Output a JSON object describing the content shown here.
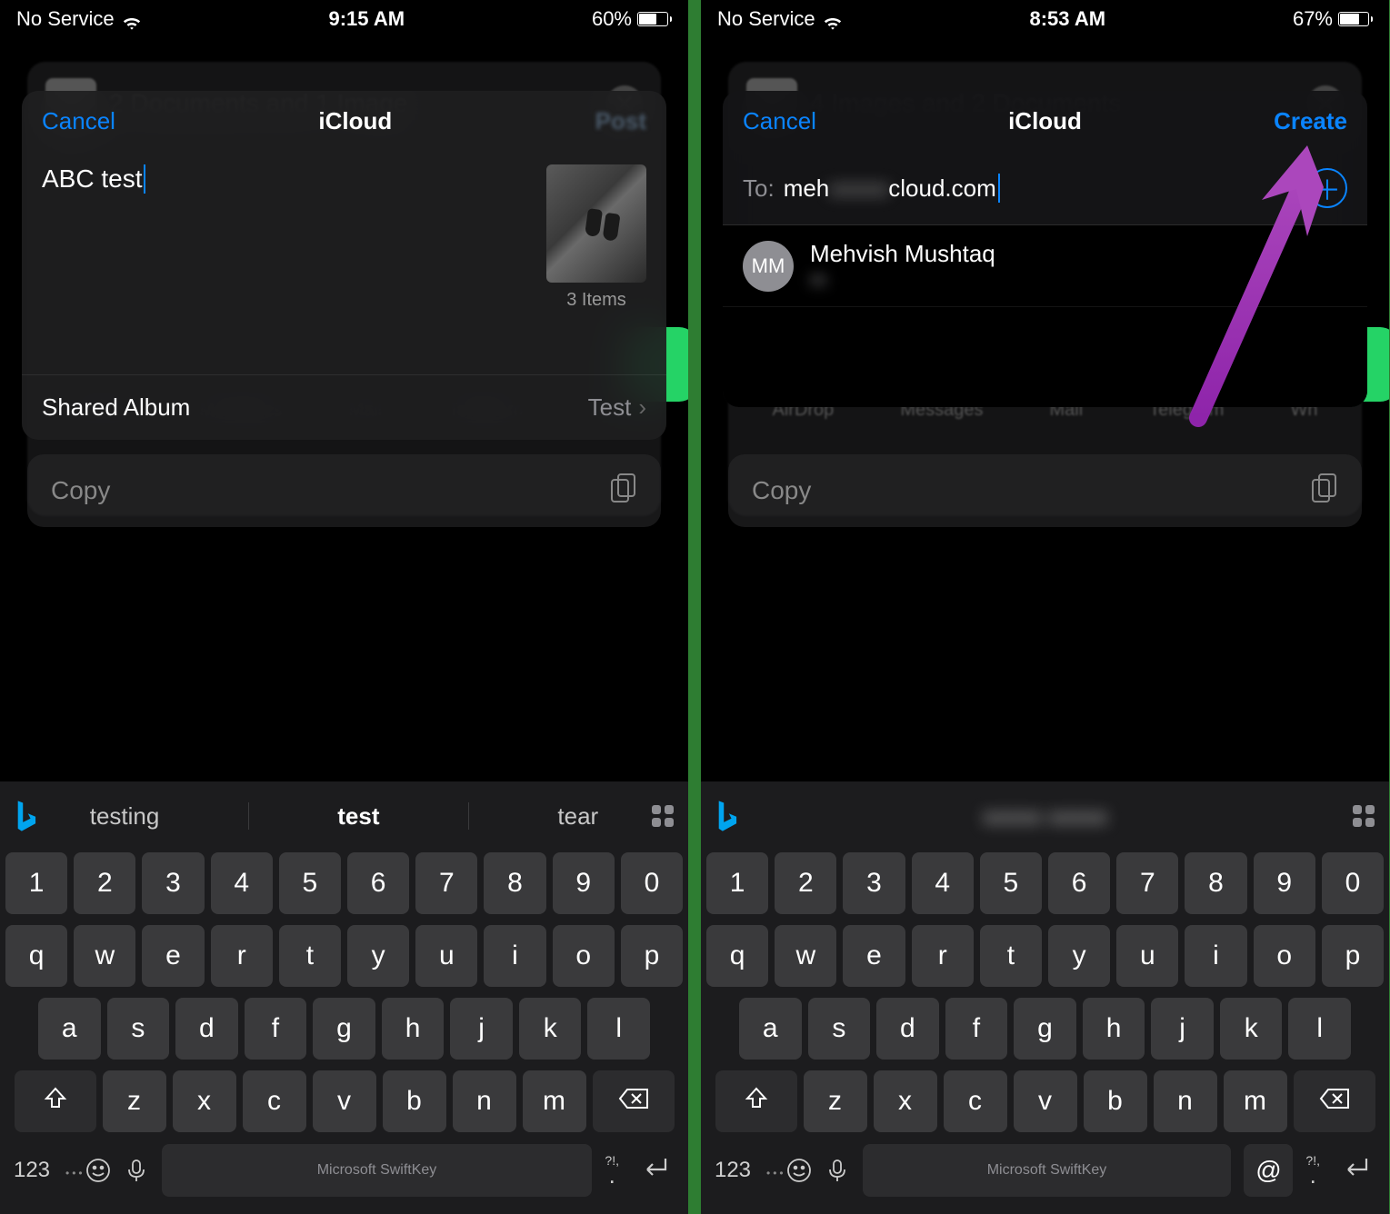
{
  "left": {
    "status": {
      "carrier": "No Service",
      "time": "9:15 AM",
      "battery_pct": "60%",
      "battery_fill": 60
    },
    "under": {
      "summary": "2 Documents and 1 Image",
      "apps": [
        "AirDrop",
        "Messages",
        "Mail",
        "Telegram",
        "Wh"
      ],
      "copy": "Copy"
    },
    "modal": {
      "cancel": "Cancel",
      "title": "iCloud",
      "action": "Post",
      "action_dim": true,
      "name_value": "ABC test",
      "items_count": "3 Items",
      "shared_label": "Shared Album",
      "shared_value": "Test"
    },
    "suggestions": [
      "testing",
      "test",
      "tear"
    ],
    "keyboard": {
      "row_num": [
        "1",
        "2",
        "3",
        "4",
        "5",
        "6",
        "7",
        "8",
        "9",
        "0"
      ],
      "row1": [
        "q",
        "w",
        "e",
        "r",
        "t",
        "y",
        "u",
        "i",
        "o",
        "p"
      ],
      "row2": [
        "a",
        "s",
        "d",
        "f",
        "g",
        "h",
        "j",
        "k",
        "l"
      ],
      "row3": [
        "z",
        "x",
        "c",
        "v",
        "b",
        "n",
        "m"
      ],
      "mode": "123",
      "space": "Microsoft SwiftKey",
      "has_at": false
    }
  },
  "right": {
    "status": {
      "carrier": "No Service",
      "time": "8:53 AM",
      "battery_pct": "67%",
      "battery_fill": 67
    },
    "under": {
      "summary": "4 Images and 2 Documents",
      "apps": [
        "AirDrop",
        "Messages",
        "Mail",
        "Telegram",
        "Wh"
      ],
      "copy": "Copy"
    },
    "modal": {
      "cancel": "Cancel",
      "title": "iCloud",
      "action": "Create",
      "action_dim": false,
      "to_label": "To:",
      "to_prefix": "meh",
      "to_blur": "vvvvv",
      "to_suffix": "cloud.com",
      "contact": {
        "initials": "MM",
        "name": "Mehvish Mushtaq",
        "email": "m                         "
      }
    },
    "suggestions_blur": true,
    "keyboard": {
      "row_num": [
        "1",
        "2",
        "3",
        "4",
        "5",
        "6",
        "7",
        "8",
        "9",
        "0"
      ],
      "row1": [
        "q",
        "w",
        "e",
        "r",
        "t",
        "y",
        "u",
        "i",
        "o",
        "p"
      ],
      "row2": [
        "a",
        "s",
        "d",
        "f",
        "g",
        "h",
        "j",
        "k",
        "l"
      ],
      "row3": [
        "z",
        "x",
        "c",
        "v",
        "b",
        "n",
        "m"
      ],
      "mode": "123",
      "space": "Microsoft SwiftKey",
      "has_at": true
    }
  }
}
